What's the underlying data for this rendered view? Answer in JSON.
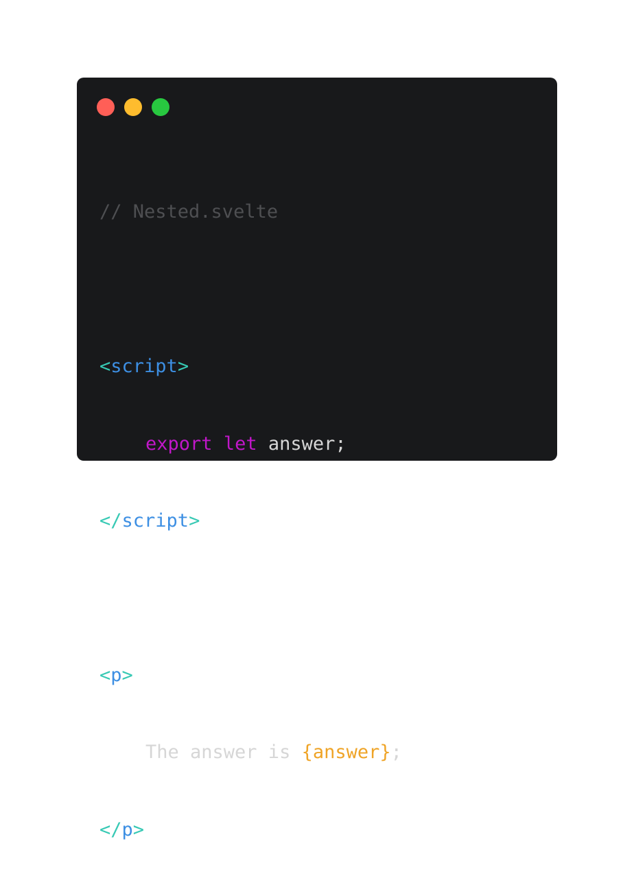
{
  "window_controls": {
    "close": {
      "color": "#ff5f57"
    },
    "minimize": {
      "color": "#febc2e"
    },
    "maximize": {
      "color": "#28c840"
    }
  },
  "code": {
    "comment": "// Nested.svelte",
    "script_open": {
      "lt": "<",
      "name": "script",
      "gt": ">"
    },
    "export_line": {
      "kw1": "export",
      "kw2": "let",
      "rest": " answer;"
    },
    "script_close": {
      "lt": "</",
      "name": "script",
      "gt": ">"
    },
    "p_open": {
      "lt": "<",
      "name": "p",
      "gt": ">"
    },
    "text_line": {
      "text": "The answer is ",
      "expr": "{answer}",
      "semi": ";"
    },
    "p_close": {
      "lt": "</",
      "name": "p",
      "gt": ">"
    }
  },
  "colors": {
    "background": "#18191b",
    "comment": "#4e4f52",
    "tag_bracket": "#37c9b4",
    "tag_name": "#3d8fe3",
    "keyword": "#c117c9",
    "text": "#d6d6d6",
    "interpolation": "#efa427"
  }
}
